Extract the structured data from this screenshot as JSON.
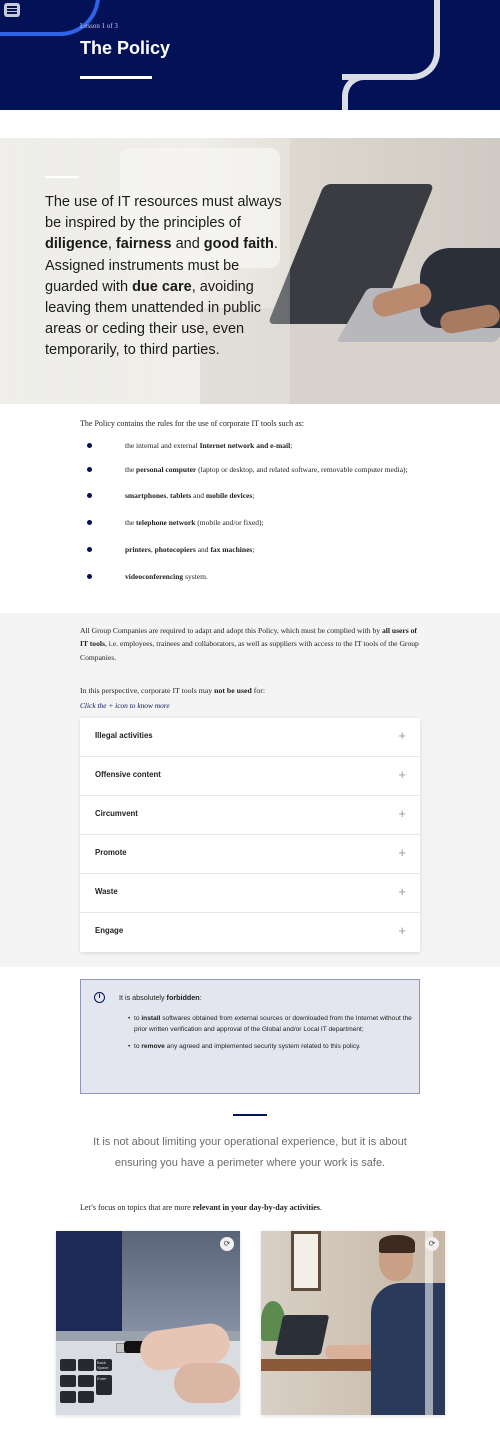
{
  "header": {
    "lesson_label": "Lesson 1 of 3",
    "title": "The Policy",
    "bg_color": "#031157",
    "accent_color": "#2f63e8"
  },
  "hero": {
    "text_1": "The use of IT resources must always be inspired by the principles of ",
    "bold_1": "diligence",
    "text_2": ", ",
    "bold_2": "fairness",
    "text_3": " and ",
    "bold_3": "good faith",
    "text_4": ". Assigned instruments must be guarded with ",
    "bold_4": "due care",
    "text_5": ", avoiding leaving them unattended in public areas or ceding their use, even temporarily, to third parties."
  },
  "policy": {
    "intro": "The Policy contains the rules for the use of corporate IT tools such as:",
    "items": [
      {
        "pre": "the internal and external ",
        "bold": "Internet network and e-mail",
        "post": ";"
      },
      {
        "pre": "the ",
        "bold": "personal computer",
        "post": " (laptop or desktop, and related software, removable computer media);"
      },
      {
        "pre": "",
        "bold": "smartphones",
        "mid1": ", ",
        "bold2": "tablets",
        "mid2": " and ",
        "bold3": "mobile devices",
        "post": ";"
      },
      {
        "pre": "the ",
        "bold": "telephone network",
        "post": " (mobile and/or fixed);"
      },
      {
        "pre": "",
        "bold": "printers",
        "mid1": ", ",
        "bold2": "photocopiers",
        "mid2": " and ",
        "bold3": "fax machines",
        "post": ";"
      },
      {
        "pre": "",
        "bold": "videoconferencing",
        "post": " system."
      }
    ]
  },
  "adoption": {
    "pre": "All Group Companies are required to adapt and adopt this Policy, which must be complied with by ",
    "bold": "all users of IT tools",
    "post": ", i.e. employees, trainees and collaborators, as well as suppliers with access to the IT tools of the Group Companies."
  },
  "perspective": {
    "pre": "In this perspective, corporate IT tools may ",
    "bold": "not be used",
    "post": " for:",
    "hint": "Click the + icon to know more"
  },
  "accordion": {
    "items": [
      "Illegal activities",
      "Offensive content",
      "Circumvent",
      "Promote",
      "Waste",
      "Engage"
    ],
    "plus": "+"
  },
  "notice": {
    "icon_glyph": "i",
    "lead_pre": "It is absolutely ",
    "lead_bold": "forbidden",
    "lead_post": ":",
    "item1_pre": "to ",
    "item1_bold": "install",
    "item1_post": " softwares obtained from external sources or downloaded from the Internet without the prior written verification and approval of the Global and/or Local IT department;",
    "item2_pre": "to ",
    "item2_bold": "remove",
    "item2_post": " any agreed and implemented security system related to this policy."
  },
  "quote": "It is not about limiting your operational experience, but it is about ensuring you have a perimeter where your work is safe.",
  "focus": {
    "pre": "Let’s focus on topics that are more ",
    "bold": "relevant in your day-by-day activities",
    "post": "."
  },
  "cards": [
    {
      "name": "usb-card",
      "flip_glyph": "⟳",
      "key_text": [
        "Back Space",
        "Enter"
      ]
    },
    {
      "name": "office-card",
      "flip_glyph": "⟳"
    }
  ]
}
